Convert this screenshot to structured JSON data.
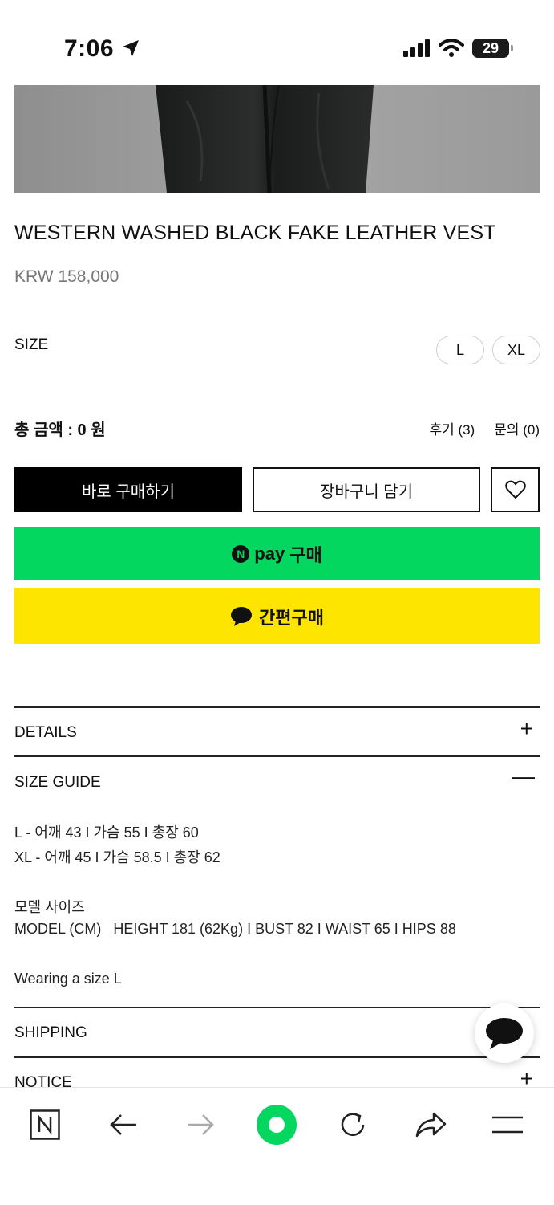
{
  "status_bar": {
    "time": "7:06",
    "battery": "29"
  },
  "product": {
    "title": "WESTERN WASHED BLACK FAKE LEATHER VEST",
    "price": "KRW 158,000"
  },
  "size": {
    "label": "SIZE",
    "options": [
      "L",
      "XL"
    ]
  },
  "total": {
    "label": "총 금액 : 0 원"
  },
  "links": {
    "reviews": "후기 (3)",
    "inquiries": "문의 (0)"
  },
  "buttons": {
    "buy_now": "바로 구매하기",
    "add_to_cart": "장바구니 담기",
    "npay_brand": "pay",
    "npay_action": "구매",
    "kakao": "간편구매"
  },
  "sections": {
    "details": "DETAILS",
    "size_guide": "SIZE GUIDE",
    "shipping": "SHIPPING",
    "notice": "NOTICE"
  },
  "size_guide": {
    "line_l": "L - 어깨 43 I 가슴 55 I 총장 60",
    "line_xl": "XL - 어깨 45 I 가슴 58.5 I 총장 62",
    "model_title": "모델 사이즈",
    "model_info": "MODEL (CM)   HEIGHT 181 (62Kg) I BUST 82 I WAIST 65 I HIPS 88",
    "wearing": "Wearing a size L"
  },
  "colors": {
    "npay": "#03d75f",
    "kakao": "#fee500",
    "brand_green": "#03c75a"
  }
}
